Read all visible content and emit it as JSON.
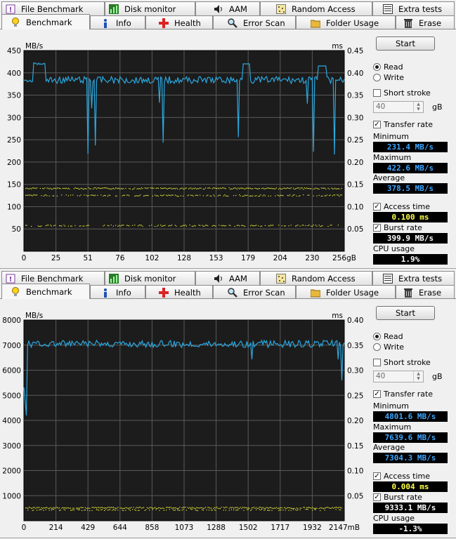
{
  "tabs_row1": [
    "File Benchmark",
    "Disk monitor",
    "AAM",
    "Random Access",
    "Extra tests"
  ],
  "tabs_row2": [
    "Benchmark",
    "Info",
    "Health",
    "Error Scan",
    "Folder Usage",
    "Erase"
  ],
  "active_tab": "Benchmark",
  "panels": [
    {
      "id": "top",
      "chart": {
        "y_unit_left": "MB/s",
        "y_unit_right": "ms",
        "y_ticks_left": [
          "450",
          "400",
          "350",
          "300",
          "250",
          "200",
          "150",
          "100",
          "50"
        ],
        "y_ticks_right": [
          "0.45",
          "0.40",
          "0.35",
          "0.30",
          "0.25",
          "0.20",
          "0.15",
          "0.10",
          "0.05"
        ],
        "x_ticks": [
          "0",
          "25",
          "51",
          "76",
          "102",
          "128",
          "153",
          "179",
          "204",
          "230",
          "256gB"
        ]
      },
      "controls": {
        "start": "Start",
        "read": "Read",
        "write": "Write",
        "short_stroke": "Short stroke",
        "stroke_value": "40",
        "stroke_unit": "gB",
        "transfer_rate": "Transfer rate",
        "minimum_label": "Minimum",
        "minimum": "231.4 MB/s",
        "maximum_label": "Maximum",
        "maximum": "422.6 MB/s",
        "average_label": "Average",
        "average": "378.5 MB/s",
        "access_time": "Access time",
        "access_value": "0.100 ms",
        "burst_rate": "Burst rate",
        "burst_value": "399.9 MB/s",
        "cpu_label": "CPU usage",
        "cpu_value": "1.9%"
      }
    },
    {
      "id": "bottom",
      "chart": {
        "y_unit_left": "MB/s",
        "y_unit_right": "ms",
        "y_ticks_left": [
          "8000",
          "7000",
          "6000",
          "5000",
          "4000",
          "3000",
          "2000",
          "1000"
        ],
        "y_ticks_right": [
          "0.40",
          "0.35",
          "0.30",
          "0.25",
          "0.20",
          "0.15",
          "0.10",
          "0.05"
        ],
        "x_ticks": [
          "0",
          "214",
          "429",
          "644",
          "858",
          "1073",
          "1288",
          "1502",
          "1717",
          "1932",
          "2147mB"
        ]
      },
      "controls": {
        "start": "Start",
        "read": "Read",
        "write": "Write",
        "short_stroke": "Short stroke",
        "stroke_value": "40",
        "stroke_unit": "gB",
        "transfer_rate": "Transfer rate",
        "minimum_label": "Minimum",
        "minimum": "4801.6 MB/s",
        "maximum_label": "Maximum",
        "maximum": "7639.6 MB/s",
        "average_label": "Average",
        "average": "7304.3 MB/s",
        "access_time": "Access time",
        "access_value": "0.004 ms",
        "burst_rate": "Burst rate",
        "burst_value": "9333.1 MB/s",
        "cpu_label": "CPU usage",
        "cpu_value": "-1.3%"
      }
    }
  ],
  "colors": {
    "chart_bg": "#1c1c1c",
    "grid": "#5a5a5a",
    "transfer_line": "#2aa8e0",
    "access_dots": "#e8e83a",
    "value_blue": "#3ea6ff",
    "value_yellow": "#ffff44"
  }
}
